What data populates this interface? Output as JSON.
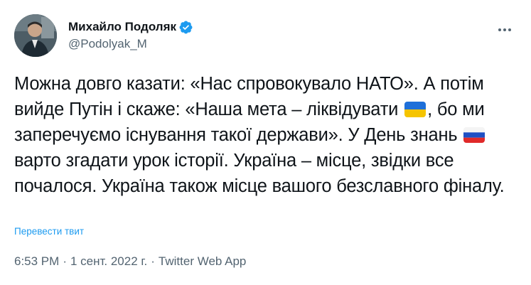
{
  "author": {
    "display_name": "Михайло Подоляк",
    "handle": "@Podolyak_M",
    "verified_icon": "verified-badge-icon",
    "accent": "#1d9bf0"
  },
  "tweet": {
    "segments": [
      "Можна довго казати: «Нас спровокувало НАТО». А потім вийде Путін і скаже: «Наша мета – ліквідувати ",
      ", бо ми заперечуємо існування такої держави». У День знань ",
      " варто згадати урок історії. Україна – місце, звідки все почалося. Україна також місце вашого безславного фіналу."
    ],
    "flags": [
      "flag-ukraine-icon",
      "flag-russia-icon"
    ],
    "translate_label": "Перевести твит"
  },
  "meta": {
    "time": "6:53 PM",
    "separator": "·",
    "date": "1 сент. 2022 г.",
    "source": "Twitter Web App"
  }
}
